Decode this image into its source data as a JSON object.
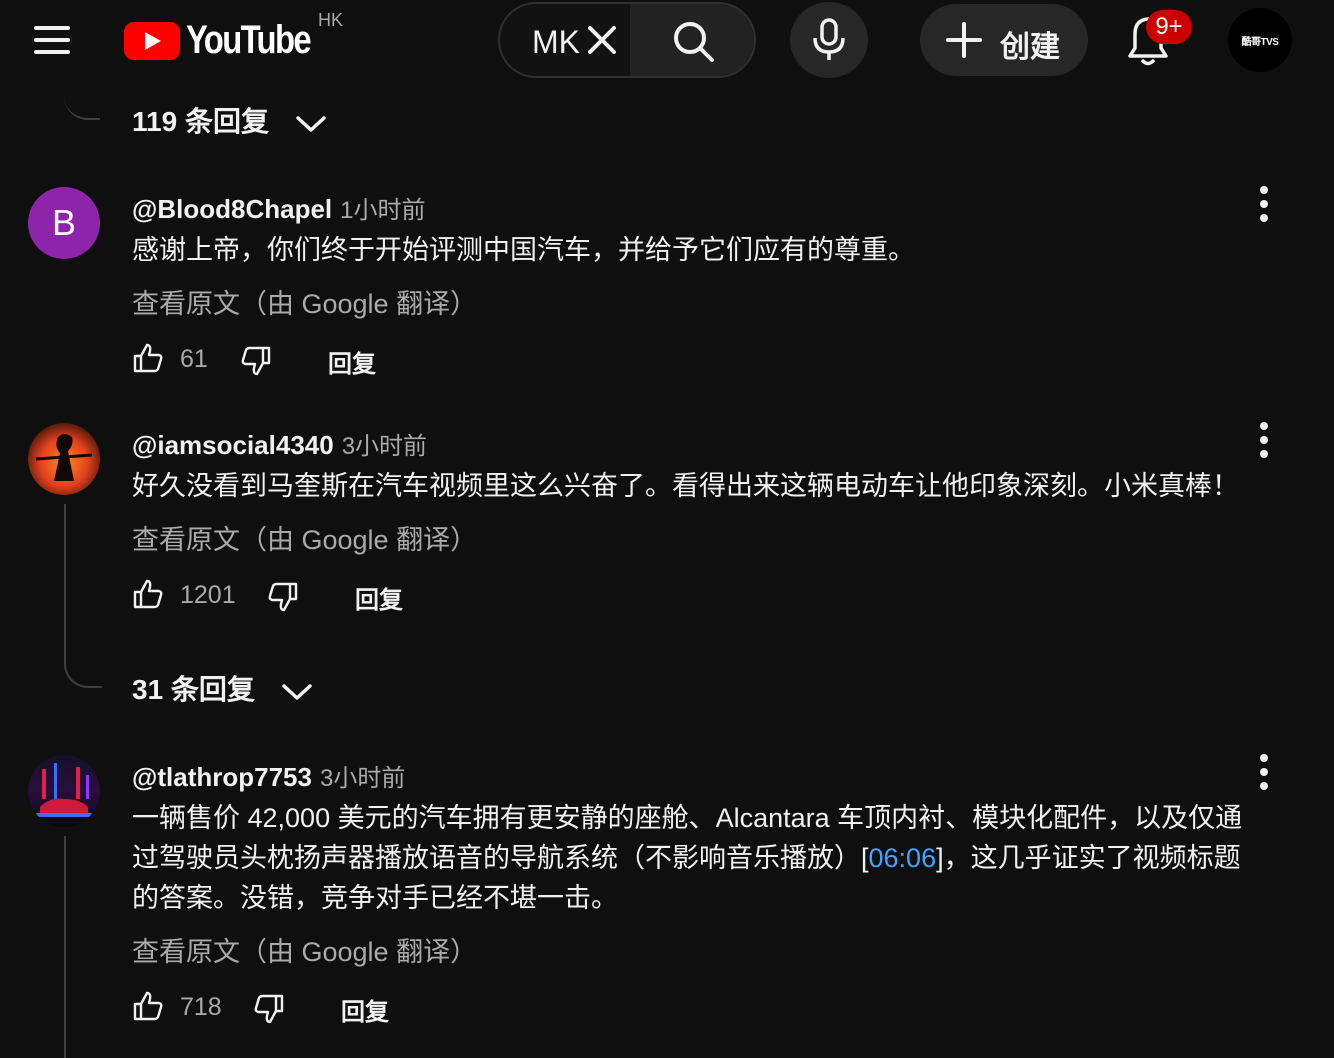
{
  "header": {
    "logo_text": "YouTube",
    "region": "HK",
    "search_value": "MK",
    "create_label": "创建",
    "notification_badge": "9+",
    "account_avatar_text": "酷哥TVS"
  },
  "comments": [
    {
      "replies_toggle": "119 条回复"
    },
    {
      "avatar_letter": "B",
      "author": "@Blood8Chapel",
      "time": "1小时前",
      "text": "感谢上帝，你们终于开始评测中国汽车，并给予它们应有的尊重。",
      "translate": "查看原文（由 Google 翻译）",
      "likes": "61",
      "reply_label": "回复"
    },
    {
      "author": "@iamsocial4340",
      "time": "3小时前",
      "text": "好久没看到马奎斯在汽车视频里这么兴奋了。看得出来这辆电动车让他印象深刻。小米真棒！",
      "translate": "查看原文（由 Google 翻译）",
      "likes": "1201",
      "reply_label": "回复",
      "replies_toggle": "31 条回复"
    },
    {
      "author": "@tlathrop7753",
      "time": "3小时前",
      "text_line1": "一辆售价 42,000 美元的汽车拥有更安静的座舱、Alcantara 车顶内衬、模块化配件，以及仅通",
      "text_line2_pre": "过驾驶员头枕扬声器播放语音的导航系统（不影响音乐播放）[",
      "text_line2_link": "06:06",
      "text_line2_post": "]，这几乎证实了视频标题",
      "text_line3": "的答案。没错，竞争对手已经不堪一击。",
      "translate": "查看原文（由 Google 翻译）",
      "likes": "718",
      "reply_label": "回复"
    }
  ],
  "colors": {
    "background": "#0f0f0f",
    "brand_red": "#ff0000",
    "badge_red": "#cc0000",
    "link_blue": "#3ea6ff",
    "secondary_text": "#aaaaaa",
    "avatar_purple": "#8e24aa"
  },
  "icons": [
    "menu-icon",
    "youtube-play-icon",
    "close-icon",
    "search-icon",
    "mic-icon",
    "plus-icon",
    "bell-icon",
    "thumb-up-icon",
    "thumb-down-icon",
    "more-vert-icon",
    "chevron-down-icon"
  ]
}
